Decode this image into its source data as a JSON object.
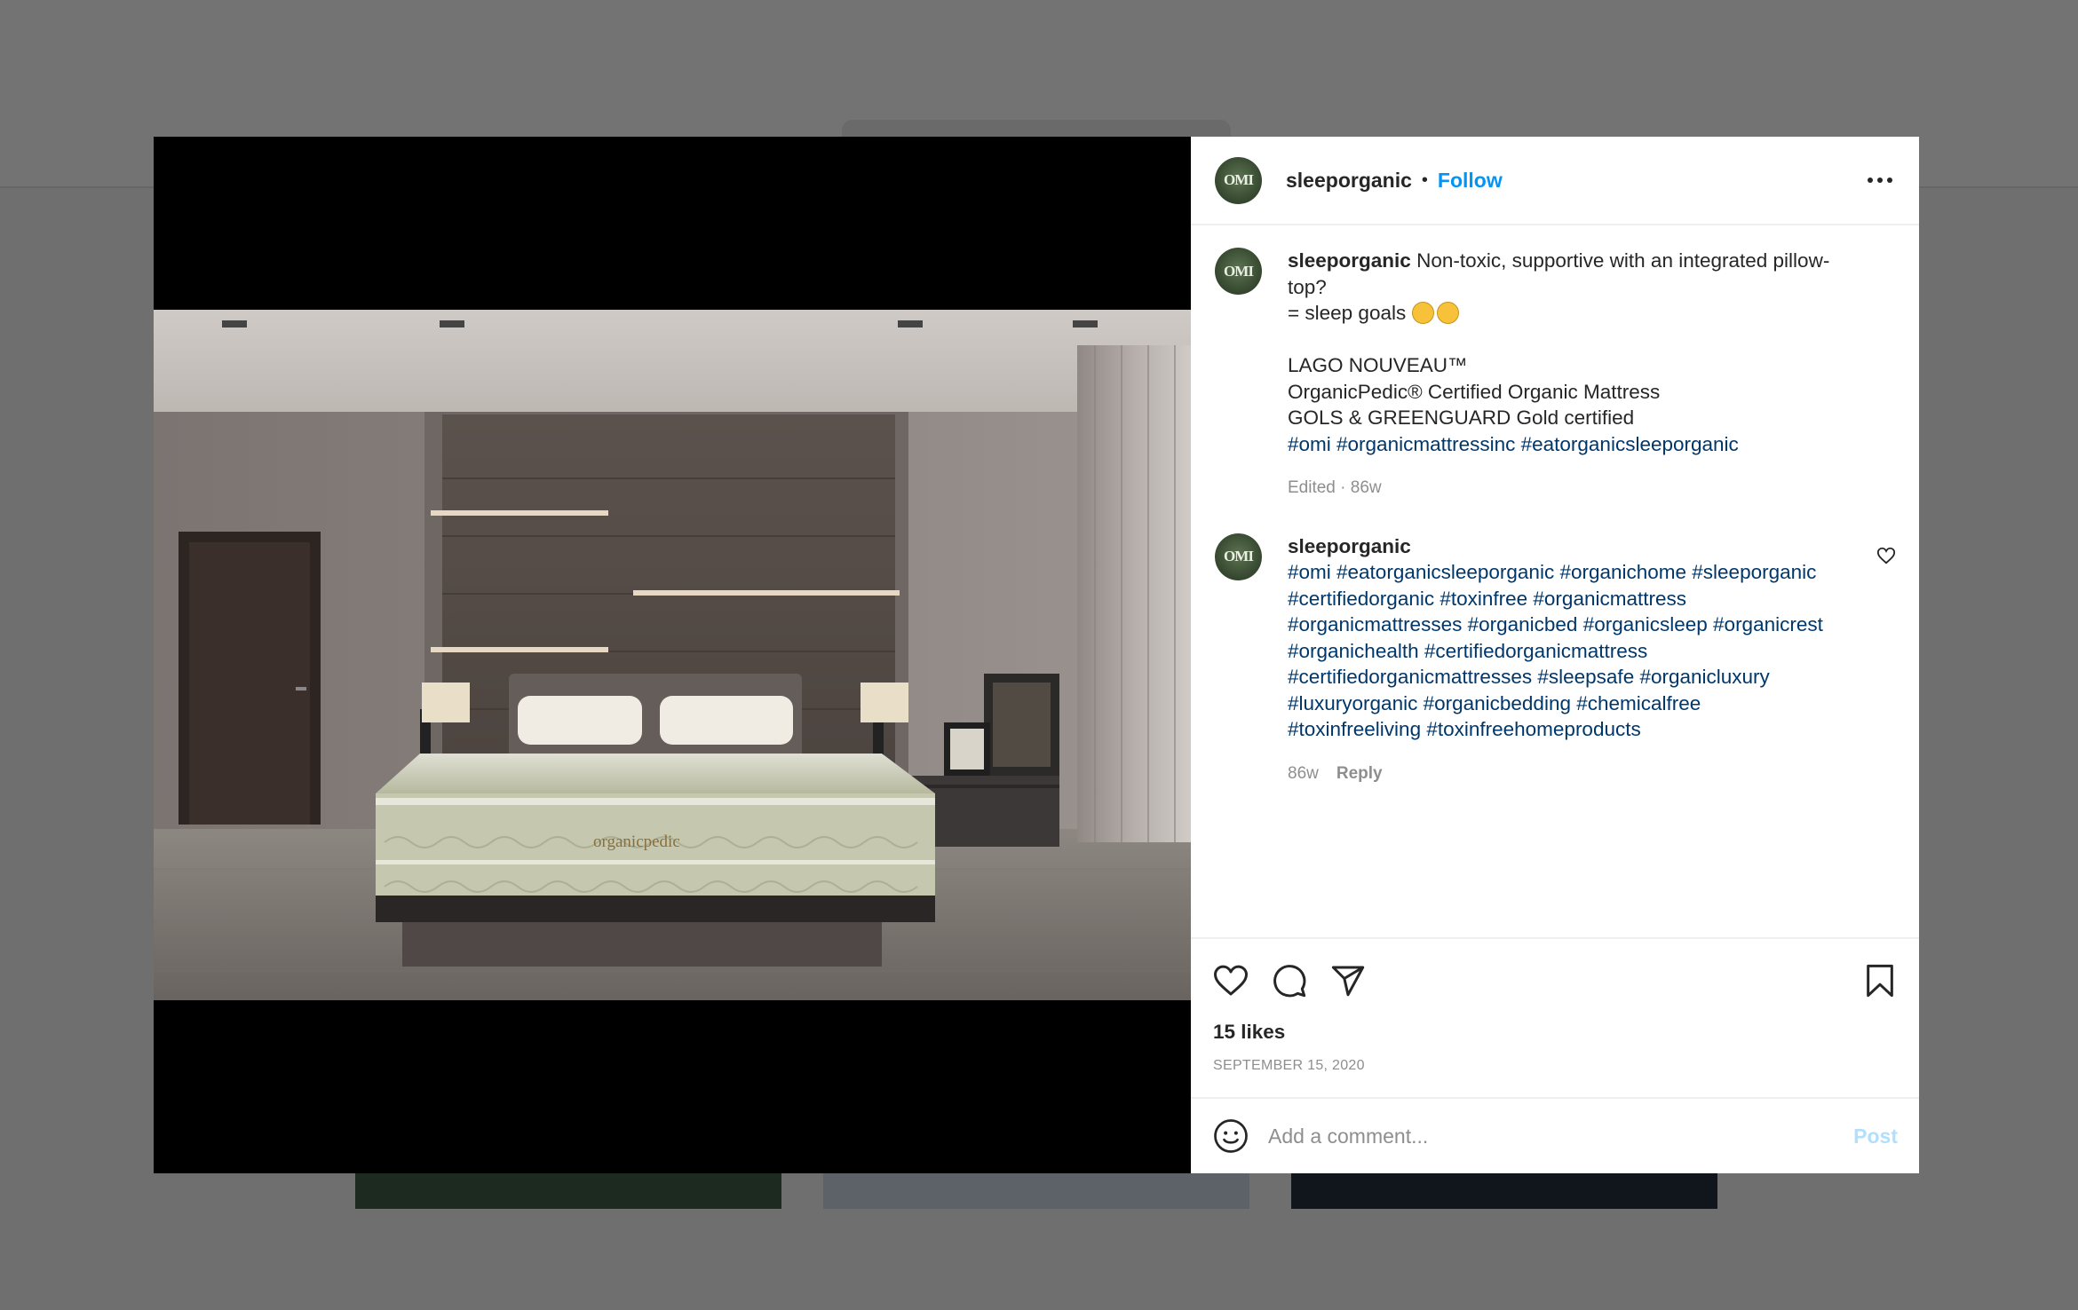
{
  "post": {
    "username": "sleeporganic",
    "avatar_text": "OMI",
    "follow_label": "Follow",
    "separator": "•",
    "caption": {
      "username": "sleeporganic",
      "line1": "Non-toxic, supportive with an integrated pillow-",
      "line2": "top?",
      "line3": "= sleep goals",
      "line4": "LAGO NOUVEAU™",
      "line5": "OrganicPedic® Certified Organic Mattress",
      "line6": "GOLS & GREENGUARD Gold certified",
      "tags_line": "#omi #organicmattressinc #eatorganicsleeporganic",
      "meta": "Edited · 86w"
    },
    "comment": {
      "username": "sleeporganic",
      "tag_lines": [
        "#omi #eatorganicsleeporganic #organichome #sleeporganic",
        "#certifiedorganic #toxinfree #organicmattress",
        "#organicmattresses #organicbed #organicsleep #organicrest",
        "#organichealth #certifiedorganicmattress",
        "#certifiedorganicmattresses #sleepsafe #organicluxury",
        "#luxuryorganic #organicbedding #chemicalfree",
        "#toxinfreeliving #toxinfreehomeproducts"
      ],
      "time": "86w",
      "reply_label": "Reply"
    },
    "likes": "15 likes",
    "date": "SEPTEMBER 15, 2020",
    "comment_placeholder": "Add a comment...",
    "post_label": "Post",
    "photo_brand": "organicpedic"
  },
  "colors": {
    "accent": "#0095f6",
    "hashtag": "#00376b",
    "muted": "#8e8e8e",
    "post_disabled": "#b2dffc"
  },
  "icons": [
    "more-options-icon",
    "heart-icon",
    "comment-icon",
    "share-icon",
    "bookmark-icon",
    "emoji-icon",
    "heart-small-icon"
  ]
}
